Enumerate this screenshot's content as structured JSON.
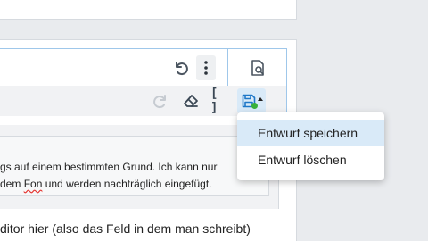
{
  "editor": {
    "text": {
      "line1": "gs auf einem bestimmten Grund. Ich kann nur",
      "line2_before": "dem ",
      "line2_misspelled": "Fon",
      "line2_after": " und werden nachträglich eingefügt."
    },
    "bottom_text": "ditor hier (also das Feld in dem man schreibt)"
  },
  "toolbar": {
    "icons": [
      "undo-icon",
      "more-vertical-icon",
      "preview-icon",
      "redo-icon",
      "eraser-icon",
      "brackets-icon",
      "save-draft-icon"
    ],
    "brackets_label": "[ ]",
    "save_status_color": "#38b03a"
  },
  "save_menu": {
    "items": [
      {
        "label": "Entwurf speichern",
        "highlighted": true
      },
      {
        "label": "Entwurf löschen",
        "highlighted": false
      }
    ]
  },
  "colors": {
    "accent": "#9fc7ea",
    "highlight": "#d9eaf8",
    "spellcheck": "#e53935"
  }
}
